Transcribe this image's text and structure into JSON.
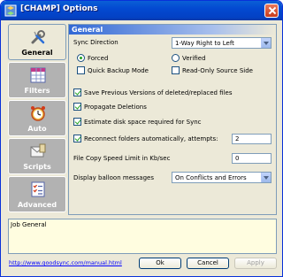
{
  "window": {
    "title": "[CHAMP] Options"
  },
  "nav": {
    "items": [
      {
        "label": "General",
        "icon": "wrench-screwdriver-icon",
        "active": true
      },
      {
        "label": "Filters",
        "icon": "grid-table-icon",
        "active": false
      },
      {
        "label": "Auto",
        "icon": "alarm-clock-icon",
        "active": false
      },
      {
        "label": "Scripts",
        "icon": "envelope-scroll-icon",
        "active": false
      },
      {
        "label": "Advanced",
        "icon": "checklist-icon",
        "active": false
      }
    ]
  },
  "panel": {
    "header": "General",
    "sync_direction": {
      "label": "Sync Direction",
      "value": "1-Way Right to Left"
    },
    "radios": [
      {
        "label": "Forced",
        "checked": true
      },
      {
        "label": "Verified",
        "checked": false
      }
    ],
    "checks_top": [
      {
        "label": "Quick Backup Mode",
        "checked": false
      },
      {
        "label": "Read-Only Source Side",
        "checked": false
      }
    ],
    "options": [
      {
        "label": "Save Previous Versions of deleted/replaced files",
        "checked": true
      },
      {
        "label": "Propagate Deletions",
        "checked": true
      },
      {
        "label": "Estimate disk space required for Sync",
        "checked": true
      },
      {
        "label": "Reconnect folders automatically, attempts:",
        "checked": true
      }
    ],
    "reconnect_attempts": "2",
    "copy_speed": {
      "label": "File Copy Speed Limit in Kb/sec",
      "value": "0"
    },
    "balloon": {
      "label": "Display balloon messages",
      "value": "On Conflicts and Errors"
    }
  },
  "description": "Job General",
  "footer": {
    "link": "http://www.goodsync.com/manual.html",
    "ok": "Ok",
    "cancel": "Cancel",
    "apply": "Apply"
  }
}
